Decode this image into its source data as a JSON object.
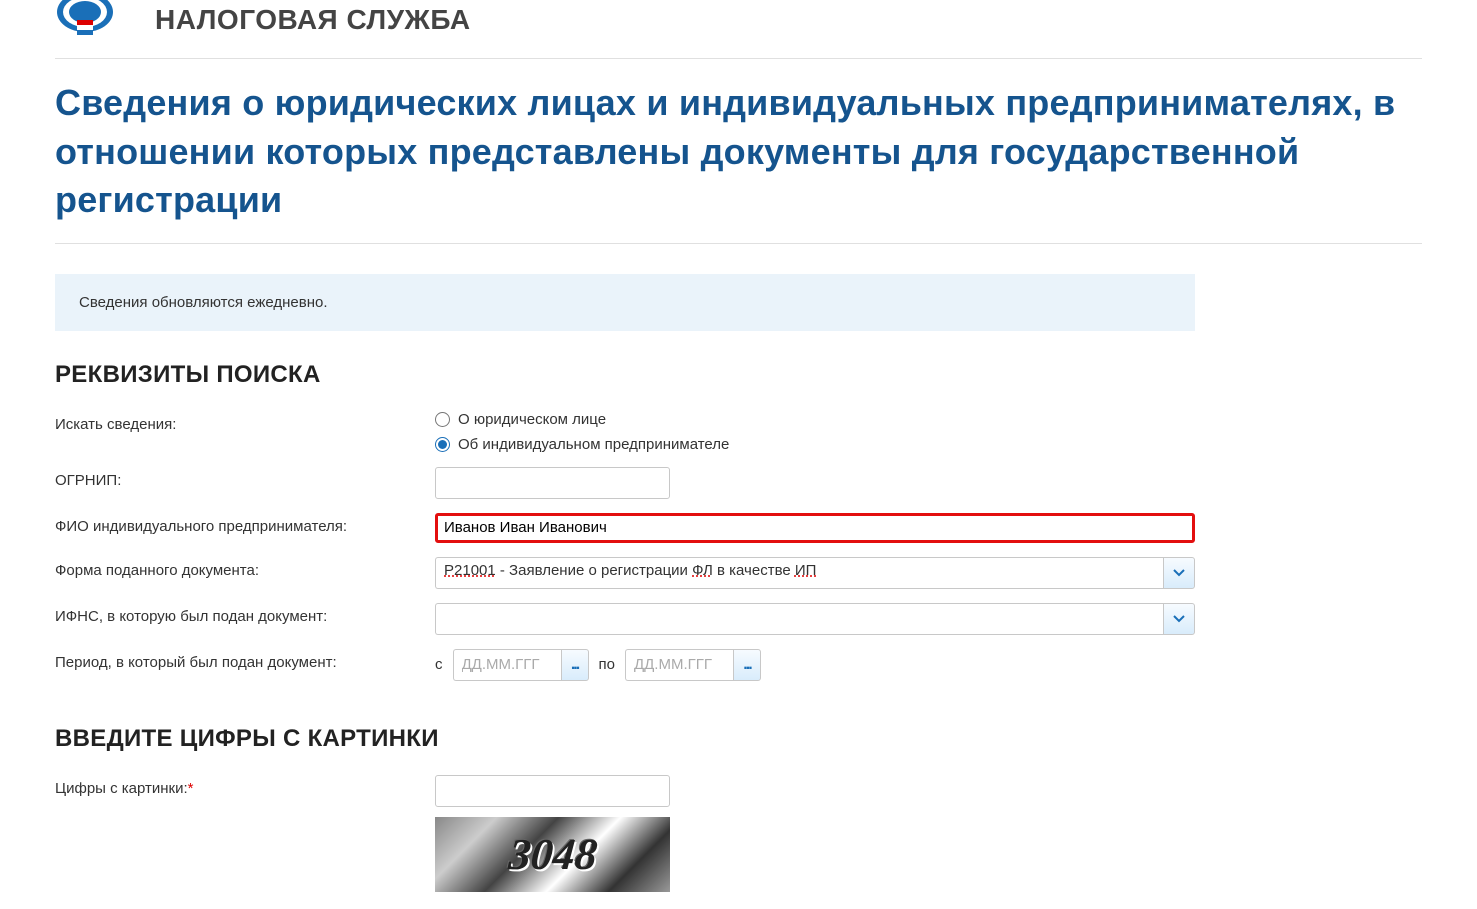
{
  "header": {
    "site_name": "НАЛОГОВАЯ СЛУЖБА"
  },
  "page_title": "Сведения о юридических лицах и индивидуальных предпринимателях, в отношении которых представлены документы для государственной регистрации",
  "info_text": "Сведения обновляются ежедневно.",
  "sections": {
    "search": {
      "title": "РЕКВИЗИТЫ ПОИСКА",
      "labels": {
        "search_what": "Искать сведения:",
        "radio_legal": "О юридическом лице",
        "radio_individual": "Об индивидуальном предпринимателе",
        "ogrnip": "ОГРНИП:",
        "fio": "ФИО индивидуального предпринимателя:",
        "doc_form": "Форма поданного документа:",
        "ifns": "ИФНС, в которую был подан документ:",
        "period": "Период, в который был подан документ:",
        "period_from": "с",
        "period_to": "по"
      },
      "values": {
        "ogrnip": "",
        "fio": "Иванов Иван Иванович",
        "doc_form_display": "Р21001 - Заявление о регистрации ФЛ в качестве ИП",
        "ifns": "",
        "date_from": "",
        "date_to": "",
        "radio_selected": "individual"
      },
      "placeholders": {
        "date": "ДД.ММ.ГГГ"
      }
    },
    "captcha": {
      "title": "ВВЕДИТЕ ЦИФРЫ С КАРТИНКИ",
      "label": "Цифры с картинки:",
      "value": "",
      "required_mark": "*",
      "captcha_hint": "3048"
    }
  }
}
